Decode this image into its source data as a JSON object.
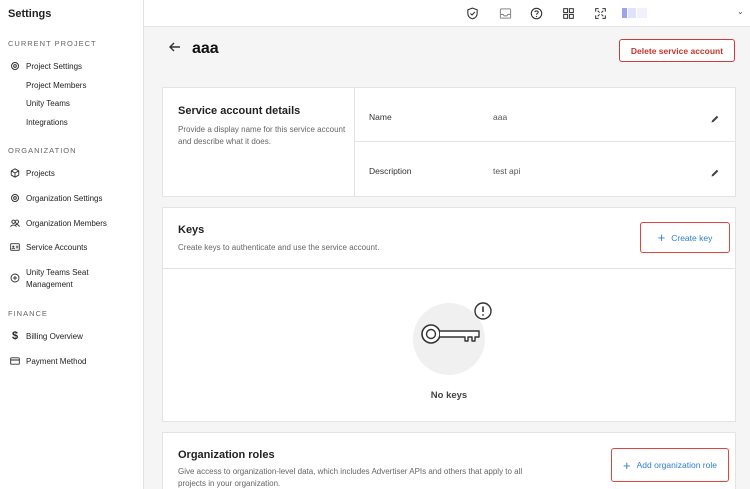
{
  "sidebar": {
    "title": "Settings",
    "sections": {
      "current_project": "CURRENT PROJECT",
      "organization": "ORGANIZATION",
      "finance": "FINANCE"
    },
    "project_items": {
      "project_settings": "Project Settings",
      "project_members": "Project Members",
      "unity_teams": "Unity Teams",
      "integrations": "Integrations"
    },
    "org_items": {
      "projects": "Projects",
      "organization_settings": "Organization Settings",
      "organization_members": "Organization Members",
      "service_accounts": "Service Accounts",
      "unity_teams_seat_line1": "Unity Teams Seat",
      "unity_teams_seat_line2": "Management"
    },
    "finance_items": {
      "billing_overview": "Billing Overview",
      "payment_method": "Payment Method"
    }
  },
  "topbar": {
    "icons": [
      "shield-check-icon",
      "inbox-icon",
      "help-icon",
      "grid-icon",
      "expand-icon"
    ],
    "avatar_colors": [
      "#c9cdf5",
      "#e6e8fb",
      "#f2f3fd"
    ]
  },
  "header": {
    "title": "aaa",
    "delete_button": "Delete service account"
  },
  "details_card": {
    "title": "Service account details",
    "description": "Provide a display name for this service account and describe what it does.",
    "name_label": "Name",
    "name_value": "aaa",
    "description_label": "Description",
    "description_value": "test api"
  },
  "keys_card": {
    "title": "Keys",
    "description": "Create keys to authenticate and use the service account.",
    "create_button": "Create key",
    "empty_text": "No keys"
  },
  "roles_card": {
    "title": "Organization roles",
    "description": "Give access to organization-level data, which includes Advertiser APIs and others that apply to all projects in your organization.",
    "add_button": "Add organization role"
  },
  "colors": {
    "accent_blue": "#2d7fd3",
    "danger_red": "#c8332e",
    "highlight_red": "#e0463d"
  }
}
